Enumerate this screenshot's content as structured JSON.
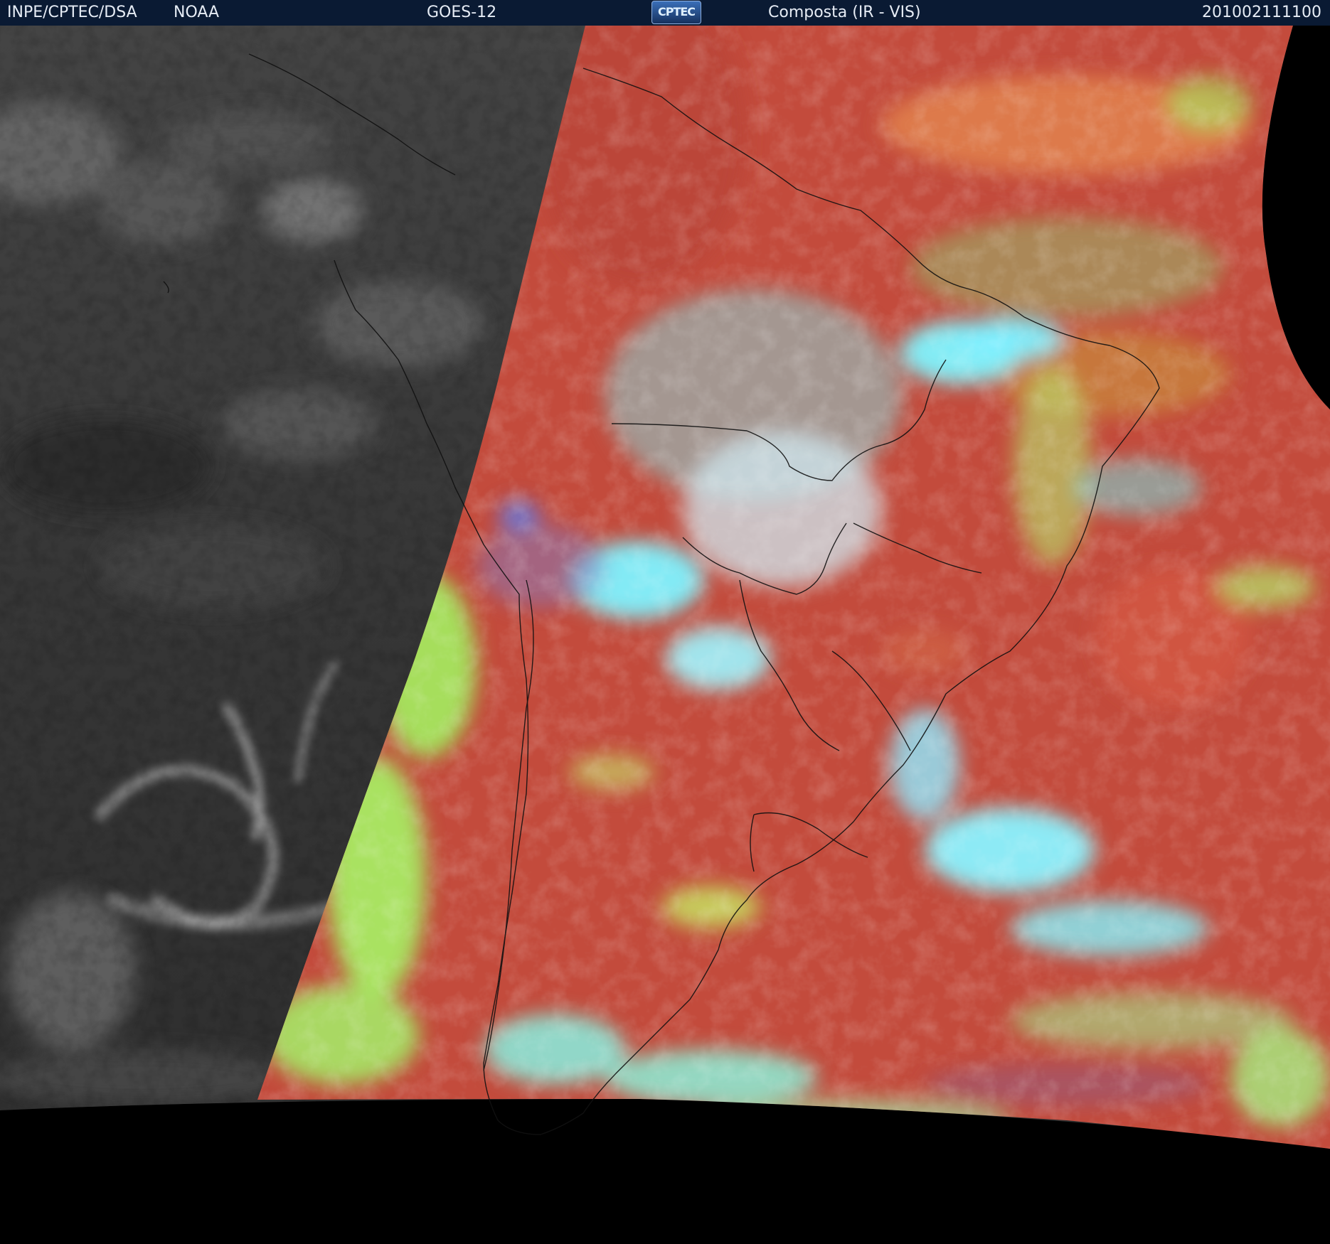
{
  "header": {
    "institute": "INPE/CPTEC/DSA",
    "agency": "NOAA",
    "satellite": "GOES-12",
    "logo_text": "CPTEC",
    "product": "Composta (IR - VIS)",
    "timestamp": "201002111100"
  },
  "colors": {
    "header_bg": "#0a1a33",
    "header_text": "#e6ecf5",
    "ir_gray": "#3a3a3a",
    "composite_red": "#c24a3a",
    "composite_cyan": "#6ff0ff",
    "composite_yellow_green": "#a8e860",
    "borders": "#111111",
    "space": "#000000"
  }
}
